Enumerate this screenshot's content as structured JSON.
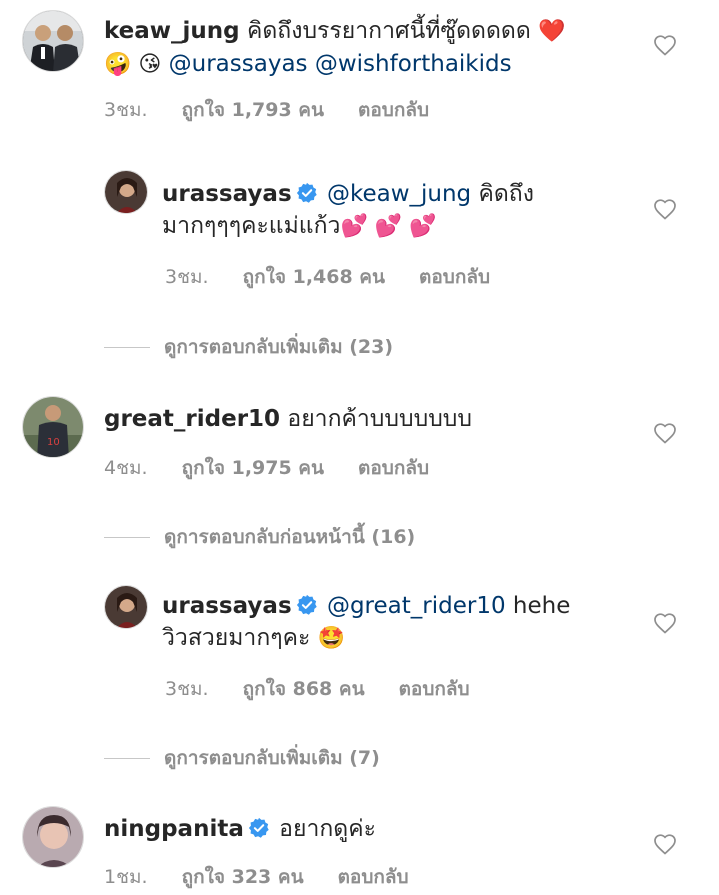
{
  "comments": [
    {
      "username": "keaw_jung",
      "text": "คิดถึงบรรยากาศนี้ที่ซู๊ดดดดด",
      "emojis_1": "❤️",
      "emojis_2": "🤪 😘",
      "mention_1": "@urassayas",
      "mention_2": "@wishforthaikids",
      "time": "3ชม.",
      "likes": "ถูกใจ 1,793 คน",
      "reply": "ตอบกลับ"
    },
    {
      "username": "urassayas",
      "mention": "@keaw_jung",
      "text_1": "คิดถึง",
      "text_2": "มากๆๆๆคะแม่แก้ว",
      "emojis": "💕 💕 💕",
      "time": "3ชม.",
      "likes": "ถูกใจ 1,468 คน",
      "reply": "ตอบกลับ"
    },
    {
      "view_more": "ดูการตอบกลับเพิ่มเติม (23)"
    },
    {
      "username": "great_rider10",
      "text": "อยากค้าบบบบบบบ",
      "time": "4ชม.",
      "likes": "ถูกใจ 1,975 คน",
      "reply": "ตอบกลับ"
    },
    {
      "view_previous": "ดูการตอบกลับก่อนหน้านี้ (16)"
    },
    {
      "username": "urassayas",
      "mention": "@great_rider10",
      "text_1": "hehe",
      "text_2": "วิวสวยมากๆคะ",
      "emojis": "🤩",
      "time": "3ชม.",
      "likes": "ถูกใจ 868 คน",
      "reply": "ตอบกลับ"
    },
    {
      "view_more": "ดูการตอบกลับเพิ่มเติม (7)"
    },
    {
      "username": "ningpanita",
      "text": "อยากดูค่ะ",
      "time": "1ชม.",
      "likes": "ถูกใจ 323 คน",
      "reply": "ตอบกลับ"
    }
  ],
  "colors": {
    "text": "#262626",
    "secondary": "#8e8e8e",
    "mention": "#00376b",
    "verified": "#3897f0",
    "heart_outline": "#8e8e8e"
  },
  "icons": {
    "verified": "verified-badge-icon",
    "like": "heart-outline-icon"
  }
}
